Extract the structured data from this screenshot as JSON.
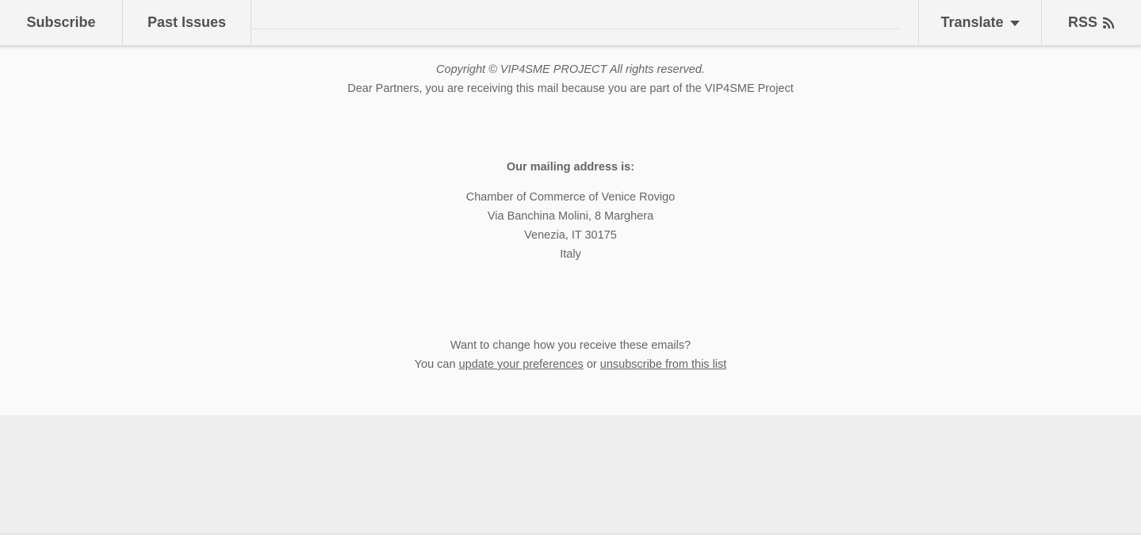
{
  "nav": {
    "subscribe_label": "Subscribe",
    "past_issues_label": "Past Issues",
    "translate_label": "Translate",
    "rss_label": "RSS"
  },
  "footer": {
    "copyright": "Copyright © VIP4SME PROJECT All rights reserved.",
    "notice": "Dear Partners, you are receiving this mail because you are part of the VIP4SME Project",
    "address_heading": "Our mailing address is:",
    "address_lines": [
      "Chamber of Commerce of Venice Rovigo",
      "Via Banchina Molini, 8 Marghera",
      "Venezia, IT 30175",
      "Italy"
    ],
    "change_prompt": "Want to change how you receive these emails?",
    "you_can": "You can",
    "update_link": "update your preferences",
    "or": "or",
    "unsubscribe_link": "unsubscribe from this list"
  },
  "icons": {
    "translate": "caret-down-icon",
    "rss": "rss-icon"
  },
  "colors": {
    "text": "#656565",
    "nav_text": "#505050",
    "nav_bg": "#f4f4f4",
    "footer_bg": "#fafafa",
    "page_bg": "#eeeeee"
  }
}
